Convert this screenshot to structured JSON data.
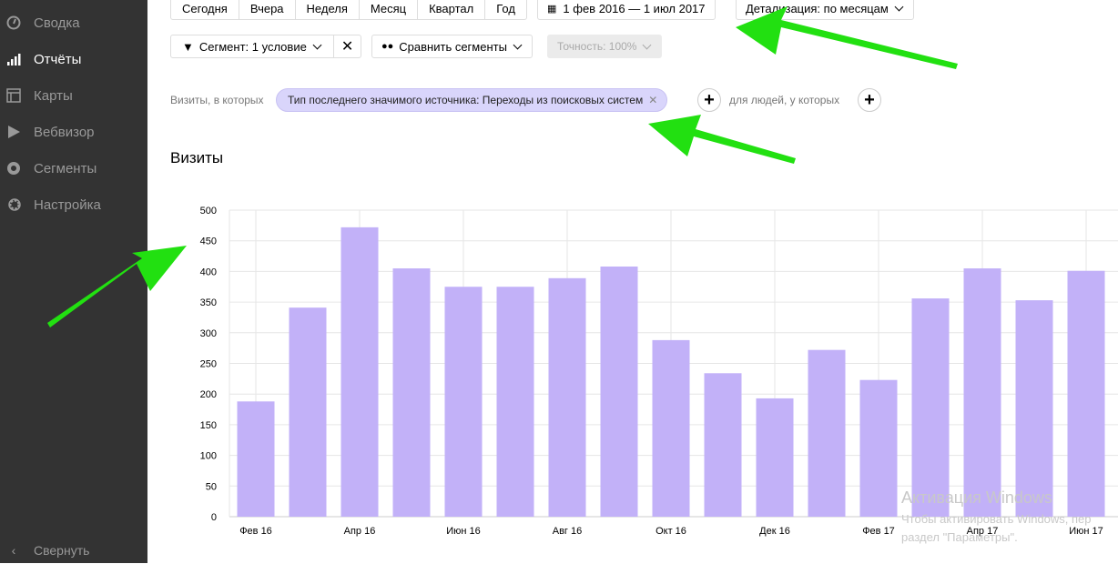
{
  "sidebar": {
    "items": [
      {
        "label": "Сводка",
        "icon": "gauge-icon"
      },
      {
        "label": "Отчёты",
        "icon": "bar-chart-icon",
        "active": true
      },
      {
        "label": "Карты",
        "icon": "map-layout-icon"
      },
      {
        "label": "Вебвизор",
        "icon": "play-icon"
      },
      {
        "label": "Сегменты",
        "icon": "donut-icon"
      },
      {
        "label": "Настройка",
        "icon": "gear-icon"
      }
    ],
    "collapse_label": "Свернуть"
  },
  "toolbar": {
    "periods": [
      "Сегодня",
      "Вчера",
      "Неделя",
      "Месяц",
      "Квартал",
      "Год"
    ],
    "date_range": "1 фев 2016 — 1 июл 2017",
    "detail": "Детализация: по месяцам",
    "segment": "Сегмент: 1 условие",
    "compare": "Сравнить сегменты",
    "accuracy": "Точность: 100%"
  },
  "filter": {
    "visits_label": "Визиты, в которых",
    "condition": "Тип последнего значимого источника: Переходы из поисковых систем",
    "people_label": "для людей, у которых"
  },
  "watermark": {
    "title": "Активация Windows",
    "line1": "Чтобы активировать Windows, пер",
    "line2": "раздел \"Параметры\"."
  },
  "chart_data": {
    "type": "bar",
    "title": "Визиты",
    "categories": [
      "Фев 16",
      "Мар 16",
      "Апр 16",
      "Май 16",
      "Июн 16",
      "Июл 16",
      "Авг 16",
      "Сен 16",
      "Окт 16",
      "Ноя 16",
      "Дек 16",
      "Янв 17",
      "Фев 17",
      "Мар 17",
      "Апр 17",
      "Май 17",
      "Июн 17"
    ],
    "tick_labels": [
      "Фев 16",
      "Апр 16",
      "Июн 16",
      "Авг 16",
      "Окт 16",
      "Дек 16",
      "Фев 17",
      "Апр 17",
      "Июн 17"
    ],
    "values": [
      188,
      341,
      472,
      405,
      375,
      375,
      389,
      408,
      288,
      234,
      193,
      272,
      223,
      356,
      405,
      353,
      401
    ],
    "yticks": [
      0,
      50,
      100,
      150,
      200,
      250,
      300,
      350,
      400,
      450,
      500
    ],
    "ylim": [
      0,
      500
    ],
    "grid": true,
    "color": "#c2b1f8"
  }
}
